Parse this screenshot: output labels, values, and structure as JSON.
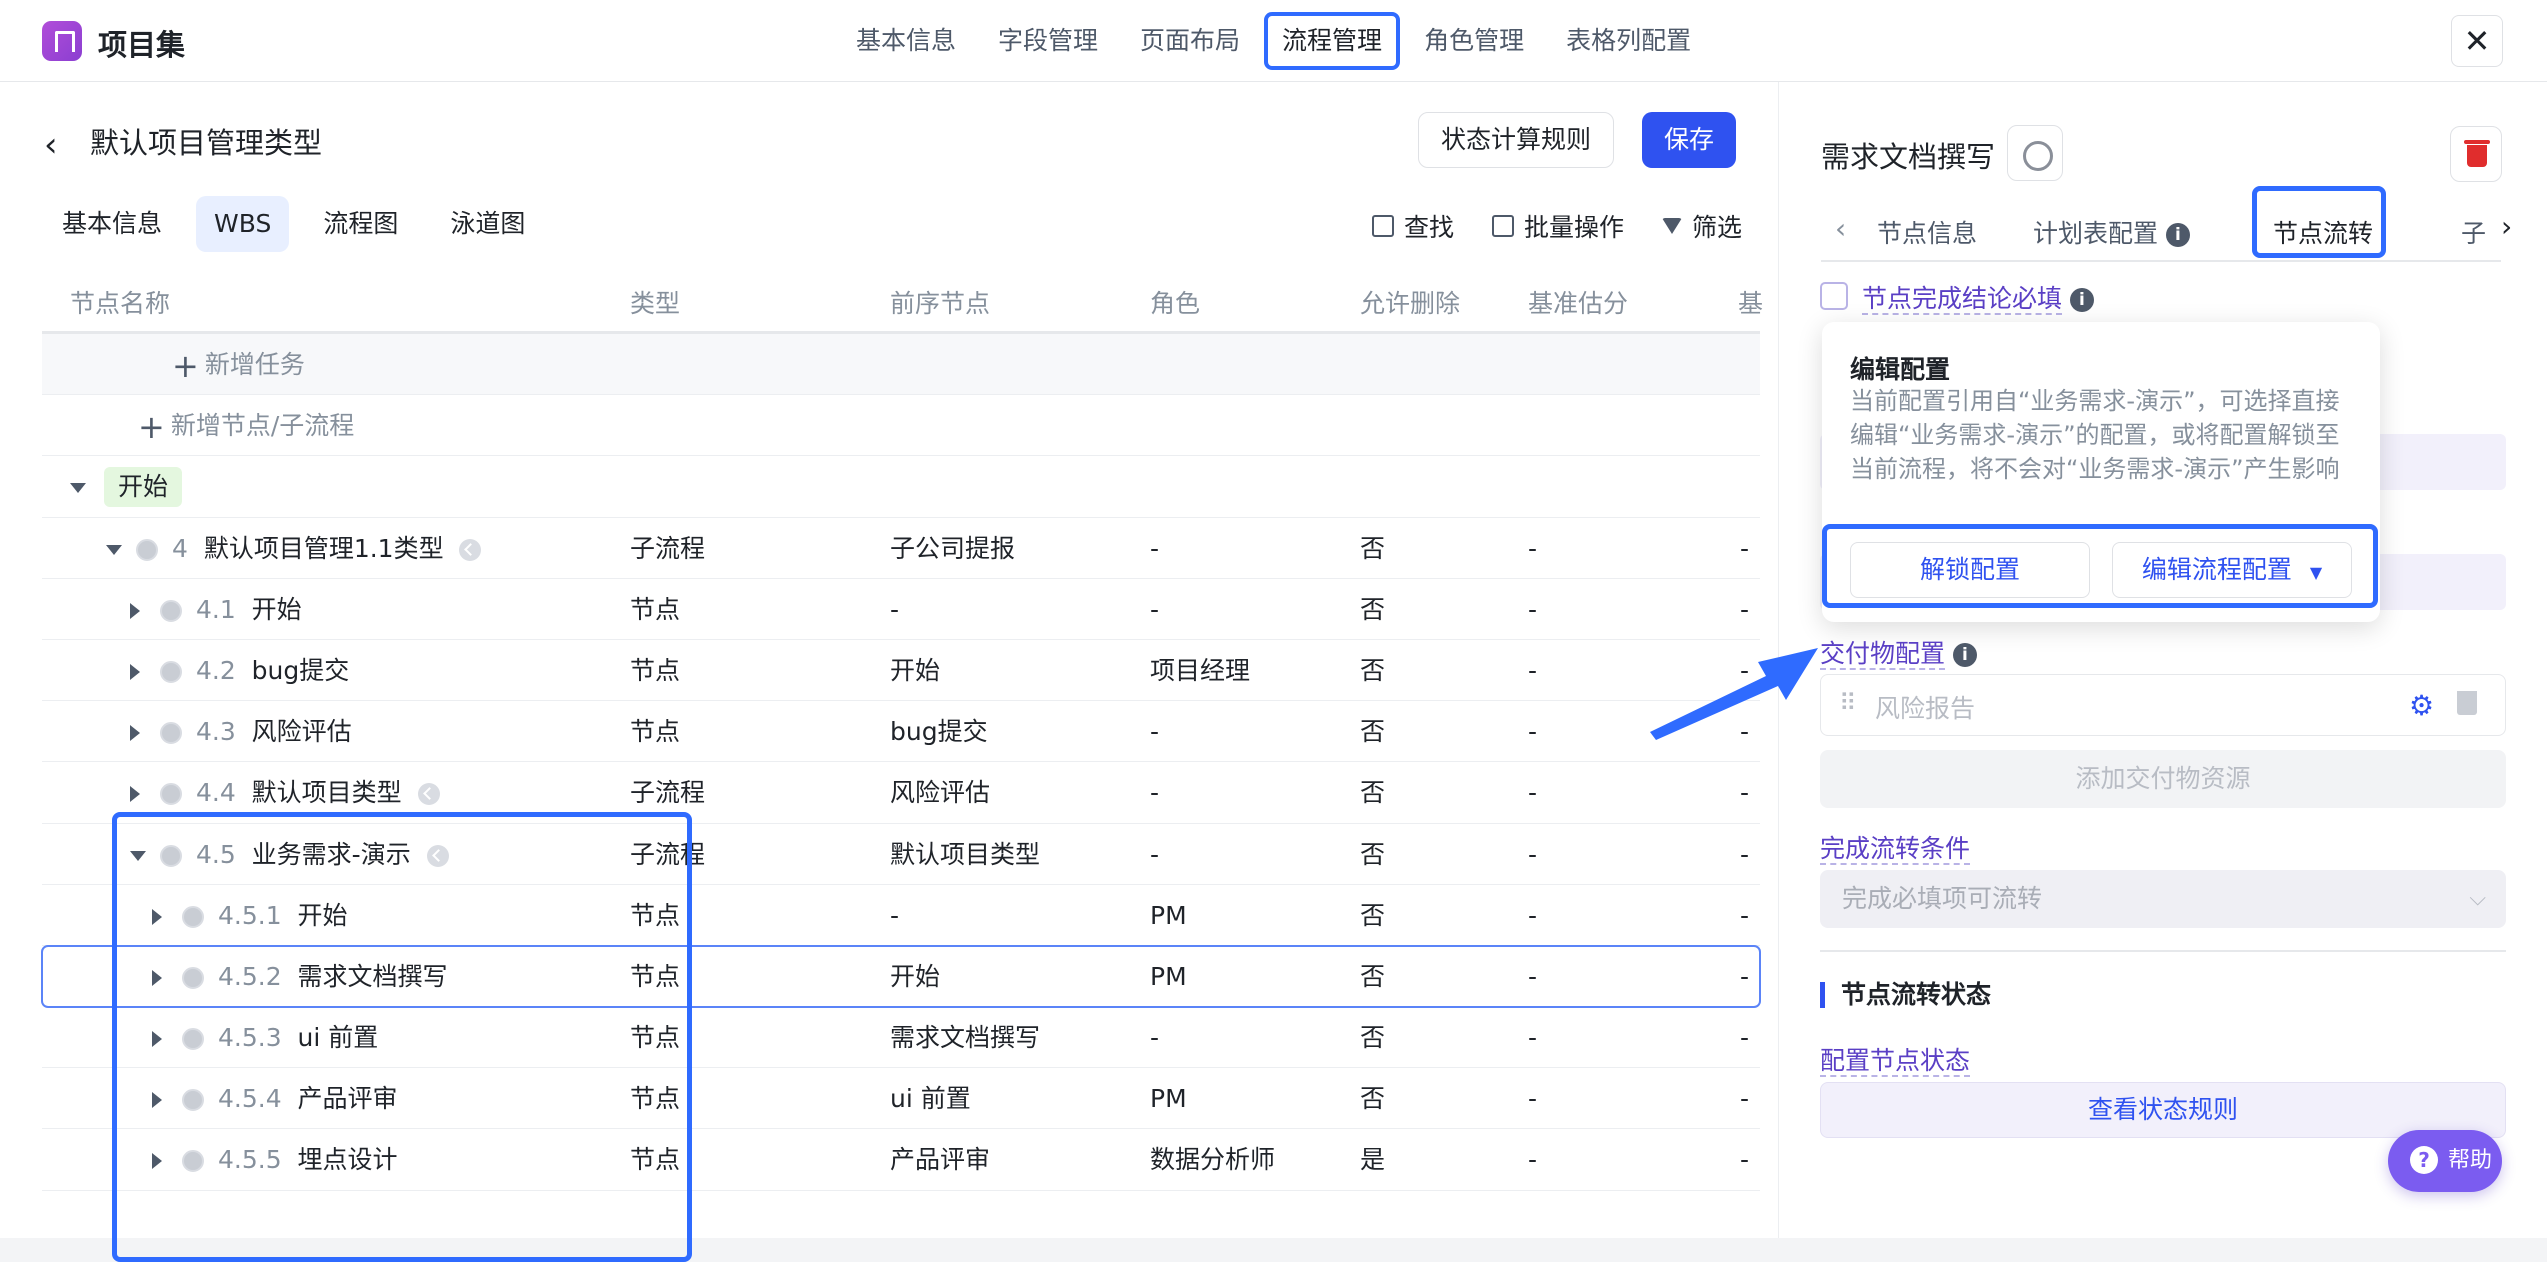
{
  "header": {
    "app_title": "项目集",
    "tabs": [
      {
        "label": "基本信息"
      },
      {
        "label": "字段管理"
      },
      {
        "label": "页面布局"
      },
      {
        "label": "流程管理"
      },
      {
        "label": "角色管理"
      },
      {
        "label": "表格列配置"
      }
    ],
    "active_tab": "流程管理",
    "close_icon": "close-icon"
  },
  "left": {
    "page_title": "默认项目管理类型",
    "rule_button": "状态计算规则",
    "save_button": "保存",
    "sub_tabs": [
      "基本信息",
      "WBS",
      "流程图",
      "泳道图"
    ],
    "active_sub_tab": "WBS",
    "tools": {
      "find": "查找",
      "batch": "批量操作",
      "filter": "筛选"
    },
    "columns": [
      "节点名称",
      "类型",
      "前序节点",
      "角色",
      "允许删除",
      "基准估分",
      "基"
    ],
    "add_task": "新增任务",
    "add_node": "新增节点/子流程",
    "start_tag": "开始",
    "rows": [
      {
        "num": "4",
        "name": "默认项目管理1.1类型",
        "sub": true,
        "type": "子流程",
        "pred": "子公司提报",
        "role": "-",
        "del": "否",
        "est": "-",
        "last": "-"
      },
      {
        "num": "4.1",
        "name": "开始",
        "type": "节点",
        "pred": "-",
        "role": "-",
        "del": "否",
        "est": "-",
        "last": "-"
      },
      {
        "num": "4.2",
        "name": "bug提交",
        "type": "节点",
        "pred": "开始",
        "role": "项目经理",
        "del": "否",
        "est": "-",
        "last": "-"
      },
      {
        "num": "4.3",
        "name": "风险评估",
        "type": "节点",
        "pred": "bug提交",
        "role": "-",
        "del": "否",
        "est": "-",
        "last": "-"
      },
      {
        "num": "4.4",
        "name": "默认项目类型",
        "sub": true,
        "type": "子流程",
        "pred": "风险评估",
        "role": "-",
        "del": "否",
        "est": "-",
        "last": "-"
      },
      {
        "num": "4.5",
        "name": "业务需求-演示",
        "sub": true,
        "type": "子流程",
        "pred": "默认项目类型",
        "role": "-",
        "del": "否",
        "est": "-",
        "last": "-"
      },
      {
        "num": "4.5.1",
        "name": "开始",
        "type": "节点",
        "pred": "-",
        "role": "PM",
        "del": "否",
        "est": "-",
        "last": "-"
      },
      {
        "num": "4.5.2",
        "name": "需求文档撰写",
        "type": "节点",
        "pred": "开始",
        "role": "PM",
        "del": "否",
        "est": "-",
        "last": "-"
      },
      {
        "num": "4.5.3",
        "name": "ui 前置",
        "type": "节点",
        "pred": "需求文档撰写",
        "role": "-",
        "del": "否",
        "est": "-",
        "last": "-"
      },
      {
        "num": "4.5.4",
        "name": "产品评审",
        "type": "节点",
        "pred": "ui 前置",
        "role": "PM",
        "del": "否",
        "est": "-",
        "last": "-"
      },
      {
        "num": "4.5.5",
        "name": "埋点设计",
        "type": "节点",
        "pred": "产品评审",
        "role": "数据分析师",
        "del": "是",
        "est": "-",
        "last": "-"
      }
    ]
  },
  "right": {
    "node_title": "需求文档撰写",
    "tabs": [
      "节点信息",
      "计划表配置",
      "节点流转",
      "子"
    ],
    "active_tab": "节点流转",
    "completion_required": "节点完成结论必填",
    "popover": {
      "title": "编辑配置",
      "body": "当前配置引用自“业务需求-演示”，可选择直接编辑“业务需求-演示”的配置，或将配置解锁至当前流程，将不会对“业务需求-演示”产生影响",
      "unlock": "解锁配置",
      "edit_flow": "编辑流程配置"
    },
    "deliverable_config": "交付物配置",
    "deliverable_item": "风险报告",
    "add_resource": "添加交付物资源",
    "complete_condition": "完成流转条件",
    "condition_value": "完成必填项可流转",
    "status_section": "节点流转状态",
    "config_status": "配置节点状态",
    "view_rules": "查看状态规则",
    "help": "帮助"
  },
  "colors": {
    "primary": "#2f52f0",
    "highlight": "#2f6bff",
    "start_tag_bg": "#e4f7df",
    "purple_link": "#5a3fc5"
  }
}
